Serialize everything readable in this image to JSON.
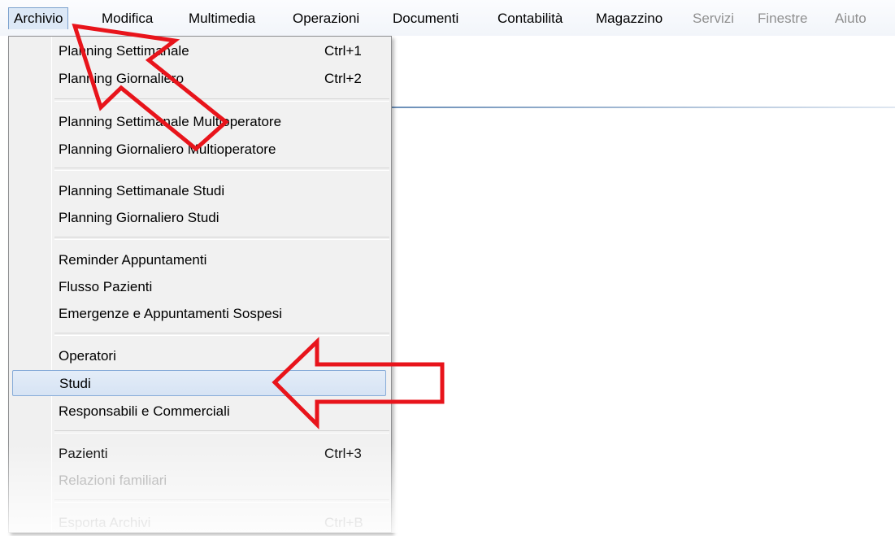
{
  "menubar": {
    "items": [
      {
        "label": "Archivio",
        "state": "active"
      },
      {
        "label": "Modifica",
        "state": "enabled"
      },
      {
        "label": "Multimedia",
        "state": "enabled"
      },
      {
        "label": "Operazioni",
        "state": "enabled"
      },
      {
        "label": "Documenti",
        "state": "enabled"
      },
      {
        "label": "Contabilità",
        "state": "enabled"
      },
      {
        "label": "Magazzino",
        "state": "enabled"
      },
      {
        "label": "Servizi",
        "state": "disabled"
      },
      {
        "label": "Finestre",
        "state": "disabled"
      },
      {
        "label": "Aiuto",
        "state": "disabled"
      }
    ]
  },
  "archivio_menu": {
    "items": [
      {
        "label": "Planning Settimanale",
        "shortcut": "Ctrl+1"
      },
      {
        "label": "Planning Giornaliero",
        "shortcut": "Ctrl+2"
      },
      {
        "label": "Planning Settimanale Multioperatore",
        "shortcut": ""
      },
      {
        "label": "Planning Giornaliero Multioperatore",
        "shortcut": ""
      },
      {
        "label": "Planning Settimanale Studi",
        "shortcut": ""
      },
      {
        "label": "Planning Giornaliero Studi",
        "shortcut": ""
      },
      {
        "label": "Reminder Appuntamenti",
        "shortcut": ""
      },
      {
        "label": "Flusso Pazienti",
        "shortcut": ""
      },
      {
        "label": "Emergenze e Appuntamenti Sospesi",
        "shortcut": ""
      },
      {
        "label": "Operatori",
        "shortcut": ""
      },
      {
        "label": "Studi",
        "shortcut": ""
      },
      {
        "label": "Responsabili e Commerciali",
        "shortcut": ""
      },
      {
        "label": "Pazienti",
        "shortcut": "Ctrl+3"
      },
      {
        "label": "Relazioni familiari",
        "shortcut": ""
      },
      {
        "label": "Esporta Archivi",
        "shortcut": "Ctrl+B"
      }
    ],
    "selected": "Studi"
  },
  "annotations": {
    "arrow_color": "#e8141b",
    "arrows": [
      "arrow-to-archivio-menu",
      "arrow-to-studi-item"
    ]
  }
}
